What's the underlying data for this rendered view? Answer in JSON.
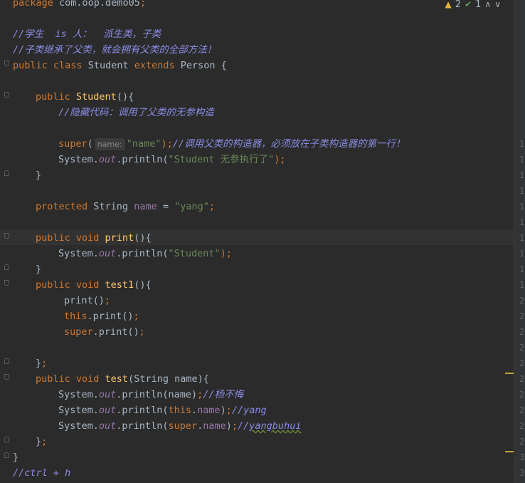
{
  "inspection": {
    "warnings": "2",
    "weak_warnings": "1",
    "warning_icon": "warning-triangle-icon",
    "check_icon": "check-icon",
    "up_icon": "chevron-up-icon",
    "down_icon": "chevron-down-icon"
  },
  "code": {
    "l0": {
      "kw": "package",
      "rest": " com.oop.demo05",
      "semi": ";"
    },
    "l2": {
      "c": "//学生  is 人：  派生类，子类"
    },
    "l3": {
      "c": "//子类继承了父类，就会拥有父类的全部方法！"
    },
    "l4": {
      "k1": "public",
      "k2": " class",
      "name": " Student ",
      "k3": "extends",
      "rest": " Person {"
    },
    "l6": {
      "k1": "public",
      "fn": " Student",
      "rest": "(){"
    },
    "l7": {
      "c": "//隐藏代码：调用了父类的无参构造"
    },
    "l9": {
      "k": "super",
      "p1": "(",
      "hint": "name:",
      "s": "\"name\"",
      "p2": ");",
      "c": "//调用父类的构造器，必须放在子类构造器的第一行！"
    },
    "l10": {
      "a": "System.",
      "f": "out",
      "b": ".println(",
      "s": "\"Student 无参执行了\"",
      "e": ");"
    },
    "l11": {
      "t": "}"
    },
    "l13": {
      "k": "protected",
      "t": " String ",
      "f": "name",
      "eq": " = ",
      "s": "\"yang\"",
      "e": ";"
    },
    "l15": {
      "k1": "public",
      "k2": " void",
      "fn": " print",
      "rest": "(){"
    },
    "l16": {
      "a": "System.",
      "f": "out",
      "b": ".println(",
      "s": "\"Student\"",
      "e": ");"
    },
    "l17": {
      "t": "}"
    },
    "l18": {
      "k1": "public",
      "k2": " void",
      "fn": " test1",
      "rest": "(){"
    },
    "l19": {
      "t": "print()",
      "e": ";"
    },
    "l20": {
      "k": "this",
      "t": ".print()",
      "e": ";"
    },
    "l21": {
      "k": "super",
      "t": ".print()",
      "e": ";"
    },
    "l23": {
      "t": "}",
      "e": ";"
    },
    "l24": {
      "k1": "public",
      "k2": " void",
      "fn": " test",
      "rest": "(String name){"
    },
    "l25": {
      "a": "System.",
      "f": "out",
      "b": ".println(name)",
      "e": ";",
      "c": "//杨不悔"
    },
    "l26": {
      "a": "System.",
      "f": "out",
      "b": ".println(",
      "k": "this",
      "m": ".",
      "fl": "name",
      "p": ")",
      "e": ";",
      "c": "//yang"
    },
    "l27": {
      "a": "System.",
      "f": "out",
      "b": ".println(",
      "k": "super",
      "m": ".",
      "fl": "name",
      "p": ")",
      "e": ";",
      "c1": "//",
      "c2": "yangbuhui"
    },
    "l28": {
      "t": "}",
      "e": ";"
    },
    "l29": {
      "t": "}"
    },
    "l30": {
      "c": "//ctrl + h"
    }
  },
  "line_numbers": [
    "10",
    "11",
    "12",
    "13",
    "14",
    "15",
    "16",
    "17",
    "18",
    "19",
    "20",
    "21",
    "22",
    "23",
    "24",
    "25",
    "26",
    "27",
    "28",
    "29",
    "30",
    "31"
  ],
  "colors": {
    "background": "#2b2b2b",
    "keyword": "#cc7832",
    "string": "#6a8759",
    "comment": "#8b8be6",
    "function": "#ffc66d",
    "field": "#9876aa",
    "warning": "#e3b341"
  }
}
